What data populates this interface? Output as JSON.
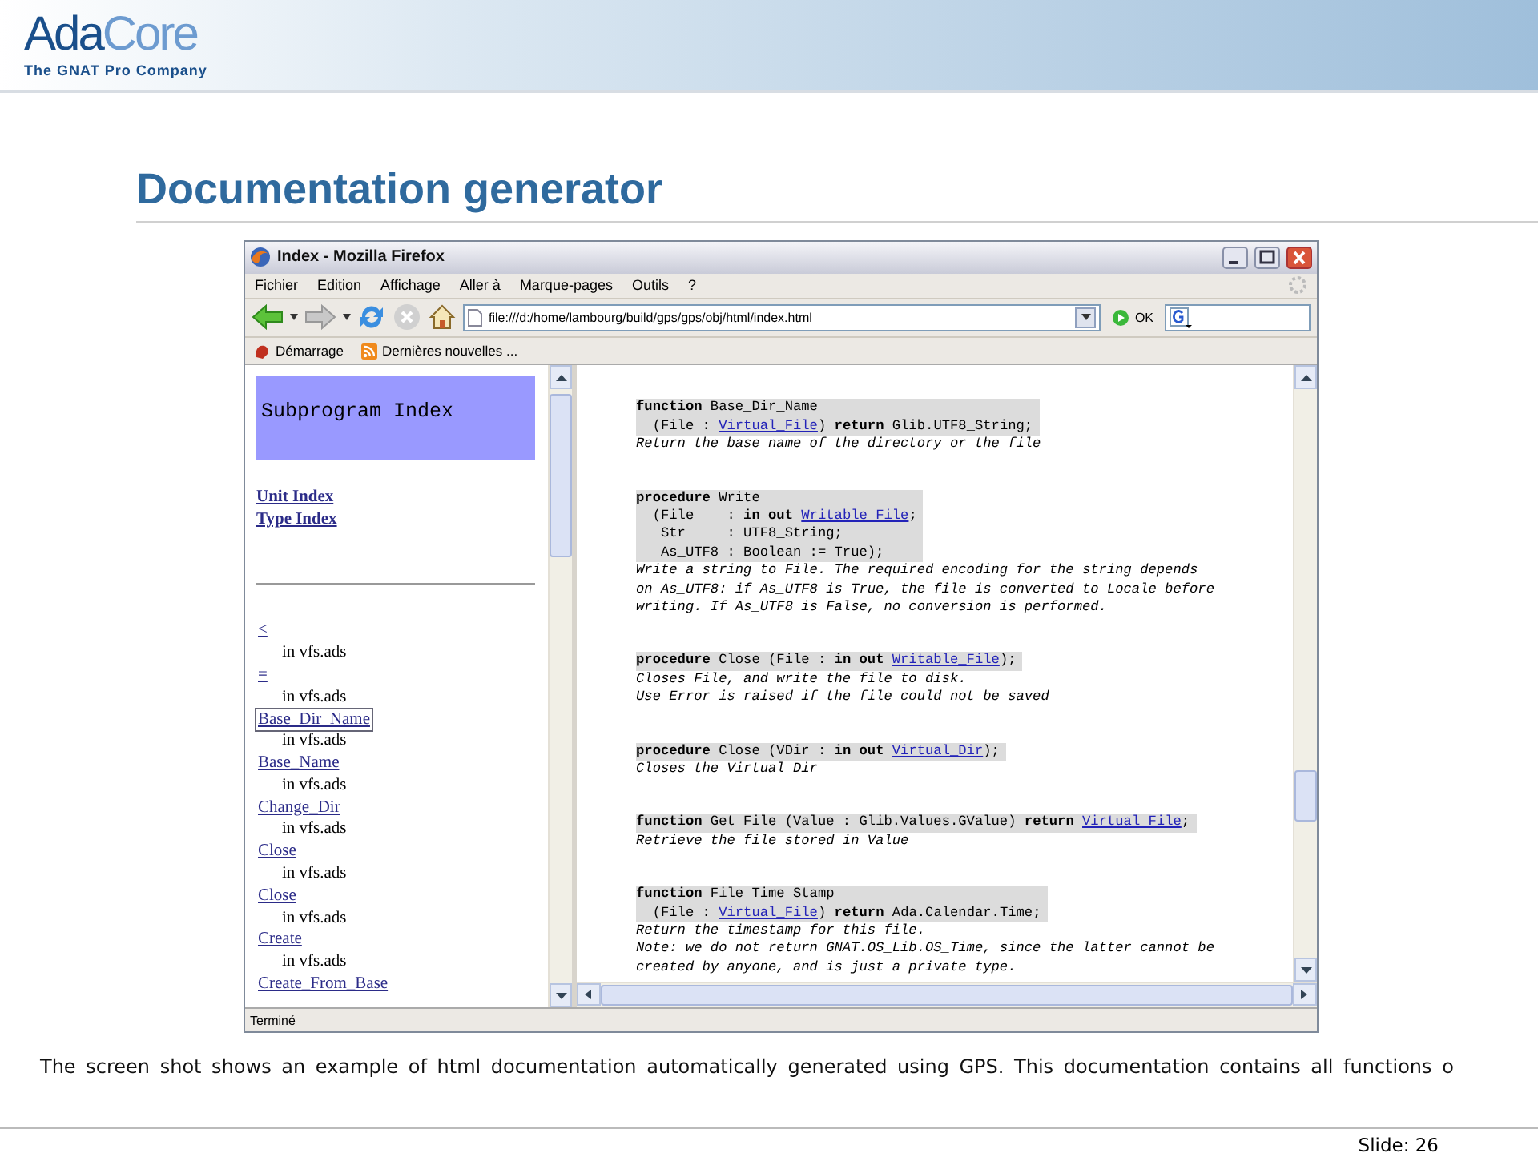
{
  "header": {
    "logo_part_1": "Ada",
    "logo_part_2": "Core",
    "tagline": "The GNAT Pro Company"
  },
  "slide_title": "Documentation generator",
  "browser": {
    "title": "Index - Mozilla Firefox",
    "menu": [
      "Fichier",
      "Edition",
      "Affichage",
      "Aller à",
      "Marque-pages",
      "Outils",
      "?"
    ],
    "address": "file:///d:/home/lambourg/build/gps/gps/obj/html/index.html",
    "go_label": "OK",
    "bookmarks": [
      {
        "kind": "page",
        "label": "Démarrage"
      },
      {
        "kind": "feed",
        "label": "Dernières nouvelles ..."
      }
    ],
    "index_frame": {
      "heading": "Subprogram Index",
      "nav_links": [
        "Unit Index",
        "Type Index"
      ],
      "entries": [
        {
          "name": "<",
          "file": "in vfs.ads",
          "selected": false
        },
        {
          "name": "=",
          "file": "in vfs.ads",
          "selected": false
        },
        {
          "name": "Base_Dir_Name",
          "file": "in vfs.ads",
          "selected": true
        },
        {
          "name": "Base_Name",
          "file": "in vfs.ads",
          "selected": false
        },
        {
          "name": "Change_Dir",
          "file": "in vfs.ads",
          "selected": false
        },
        {
          "name": "Close",
          "file": "in vfs.ads",
          "selected": false
        },
        {
          "name": "Close",
          "file": "in vfs.ads",
          "selected": false
        },
        {
          "name": "Create",
          "file": "in vfs.ads",
          "selected": false
        },
        {
          "name": "Create_From_Base",
          "selected": false
        }
      ]
    },
    "doc_frame": {
      "entries": [
        {
          "signature": [
            [
              {
                "kind": "kw",
                "text": "function"
              },
              {
                "kind": "plain",
                "text": " Base_Dir_Name"
              }
            ],
            [
              {
                "kind": "plain",
                "text": "  (File : "
              },
              {
                "kind": "link",
                "text": "Virtual_File"
              },
              {
                "kind": "plain",
                "text": ") "
              },
              {
                "kind": "kw",
                "text": "return"
              },
              {
                "kind": "plain",
                "text": " Glib.UTF8_String;"
              }
            ]
          ],
          "description": [
            "Return the base name of the directory or the file"
          ]
        },
        {
          "signature": [
            [
              {
                "kind": "kw",
                "text": "procedure"
              },
              {
                "kind": "plain",
                "text": " Write"
              }
            ],
            [
              {
                "kind": "plain",
                "text": "  (File    : "
              },
              {
                "kind": "kw",
                "text": "in out "
              },
              {
                "kind": "link",
                "text": "Writable_File"
              },
              {
                "kind": "plain",
                "text": ";"
              }
            ],
            [
              {
                "kind": "plain",
                "text": "   Str     : UTF8_String;"
              }
            ],
            [
              {
                "kind": "plain",
                "text": "   As_UTF8 : Boolean := True);"
              }
            ]
          ],
          "description": [
            "Write a string to File. The required encoding for the string depends",
            "on As_UTF8: if As_UTF8 is True, the file is converted to Locale before",
            "writing. If As_UTF8 is False, no conversion is performed."
          ]
        },
        {
          "signature": [
            [
              {
                "kind": "kw",
                "text": "procedure"
              },
              {
                "kind": "plain",
                "text": " Close (File : "
              },
              {
                "kind": "kw",
                "text": "in out "
              },
              {
                "kind": "link",
                "text": "Writable_File"
              },
              {
                "kind": "plain",
                "text": ");"
              }
            ]
          ],
          "description": [
            "Closes File, and write the file to disk.",
            "Use_Error is raised if the file could not be saved"
          ]
        },
        {
          "signature": [
            [
              {
                "kind": "kw",
                "text": "procedure"
              },
              {
                "kind": "plain",
                "text": " Close (VDir : "
              },
              {
                "kind": "kw",
                "text": "in out "
              },
              {
                "kind": "link",
                "text": "Virtual_Dir"
              },
              {
                "kind": "plain",
                "text": ");"
              }
            ]
          ],
          "description": [
            "Closes the Virtual_Dir"
          ]
        },
        {
          "signature": [
            [
              {
                "kind": "kw",
                "text": "function"
              },
              {
                "kind": "plain",
                "text": " Get_File (Value : Glib.Values.GValue) "
              },
              {
                "kind": "kw",
                "text": "return "
              },
              {
                "kind": "link",
                "text": "Virtual_File"
              },
              {
                "kind": "plain",
                "text": ";"
              }
            ]
          ],
          "description": [
            "Retrieve the file stored in Value"
          ]
        },
        {
          "signature": [
            [
              {
                "kind": "kw",
                "text": "function"
              },
              {
                "kind": "plain",
                "text": " File_Time_Stamp"
              }
            ],
            [
              {
                "kind": "plain",
                "text": "  (File : "
              },
              {
                "kind": "link",
                "text": "Virtual_File"
              },
              {
                "kind": "plain",
                "text": ") "
              },
              {
                "kind": "kw",
                "text": "return"
              },
              {
                "kind": "plain",
                "text": " Ada.Calendar.Time;"
              }
            ]
          ],
          "description": [
            "Return the timestamp for this file.",
            "Note: we do not return GNAT.OS_Lib.OS_Time, since the latter cannot be",
            "created by anyone, and is just a private type."
          ]
        }
      ]
    },
    "status": "Terminé"
  },
  "caption": "The screen shot shows an example of html documentation automatically generated using GPS. This documentation contains all functions o",
  "slide_number": "Slide: 26"
}
